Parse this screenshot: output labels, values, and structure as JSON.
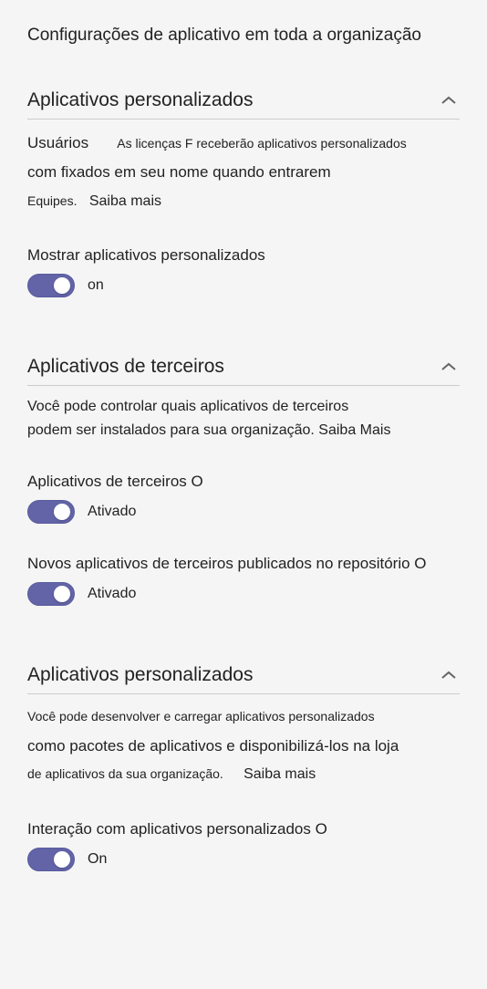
{
  "page_title": "Configurações de aplicativo em toda a organização",
  "section1": {
    "title": "Aplicativos personalizados",
    "desc_p1a": "Usuários",
    "desc_p1b": "As licenças F receberão aplicativos personalizados",
    "desc_p2": "com fixados em seu nome quando entrarem",
    "desc_p3a": "Equipes.",
    "learn_more": "Saiba mais",
    "toggle1": {
      "label": "Mostrar aplicativos personalizados",
      "state": "on"
    }
  },
  "section2": {
    "title": "Aplicativos de terceiros",
    "desc_l1": "Você pode controlar quais aplicativos de terceiros",
    "desc_l2": "podem ser instalados para sua organização. Saiba Mais",
    "toggle1": {
      "label": "Aplicativos de terceiros O",
      "state": "Ativado"
    },
    "toggle2": {
      "label": "Novos aplicativos de terceiros publicados no repositório O",
      "state": "Ativado"
    }
  },
  "section3": {
    "title": "Aplicativos personalizados",
    "desc_l1": "Você pode desenvolver e carregar aplicativos personalizados",
    "desc_l2": "como pacotes de aplicativos e disponibilizá-los na loja",
    "desc_l3a": "de aplicativos da sua organização.",
    "learn_more": "Saiba mais",
    "toggle1": {
      "label": "Interação com aplicativos personalizados O",
      "state": "On"
    }
  }
}
